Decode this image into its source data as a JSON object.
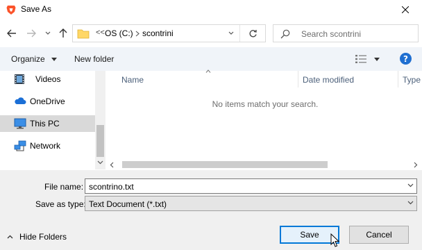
{
  "window": {
    "title": "Save As",
    "app_icon": "brave-lion-icon",
    "close_icon": "close-icon"
  },
  "nav": {
    "back_icon": "arrow-left-icon",
    "forward_icon": "arrow-right-icon",
    "recent_icon": "chevron-down-icon",
    "up_icon": "arrow-up-icon"
  },
  "address": {
    "overflow_label": "<<",
    "segments": [
      "OS (C:)",
      "scontrini"
    ],
    "separator_icon": "chevron-right-icon",
    "refresh_icon": "refresh-icon"
  },
  "search": {
    "placeholder": "Search scontrini"
  },
  "toolbar": {
    "organize_label": "Organize",
    "new_folder_label": "New folder",
    "view_icon": "view-details-icon",
    "help_icon": "help-icon"
  },
  "sidebar": {
    "items": [
      {
        "label": "Videos",
        "icon": "film-icon"
      },
      {
        "label": "OneDrive",
        "icon": "cloud-icon"
      },
      {
        "label": "This PC",
        "icon": "monitor-icon",
        "selected": true
      },
      {
        "label": "Network",
        "icon": "network-icon"
      }
    ]
  },
  "files": {
    "columns": [
      "Name",
      "Date modified",
      "Type"
    ],
    "empty_message": "No items match your search."
  },
  "form": {
    "filename_label": "File name:",
    "filename_value": "scontrino.txt",
    "filetype_label": "Save as type:",
    "filetype_value": "Text Document (*.txt)"
  },
  "footer": {
    "hide_folders_label": "Hide Folders",
    "save_label": "Save",
    "cancel_label": "Cancel"
  },
  "colors": {
    "accent": "#0078d7",
    "cmdbar_bg": "#f0f4f9",
    "selection_bg": "#d9d9d9"
  }
}
